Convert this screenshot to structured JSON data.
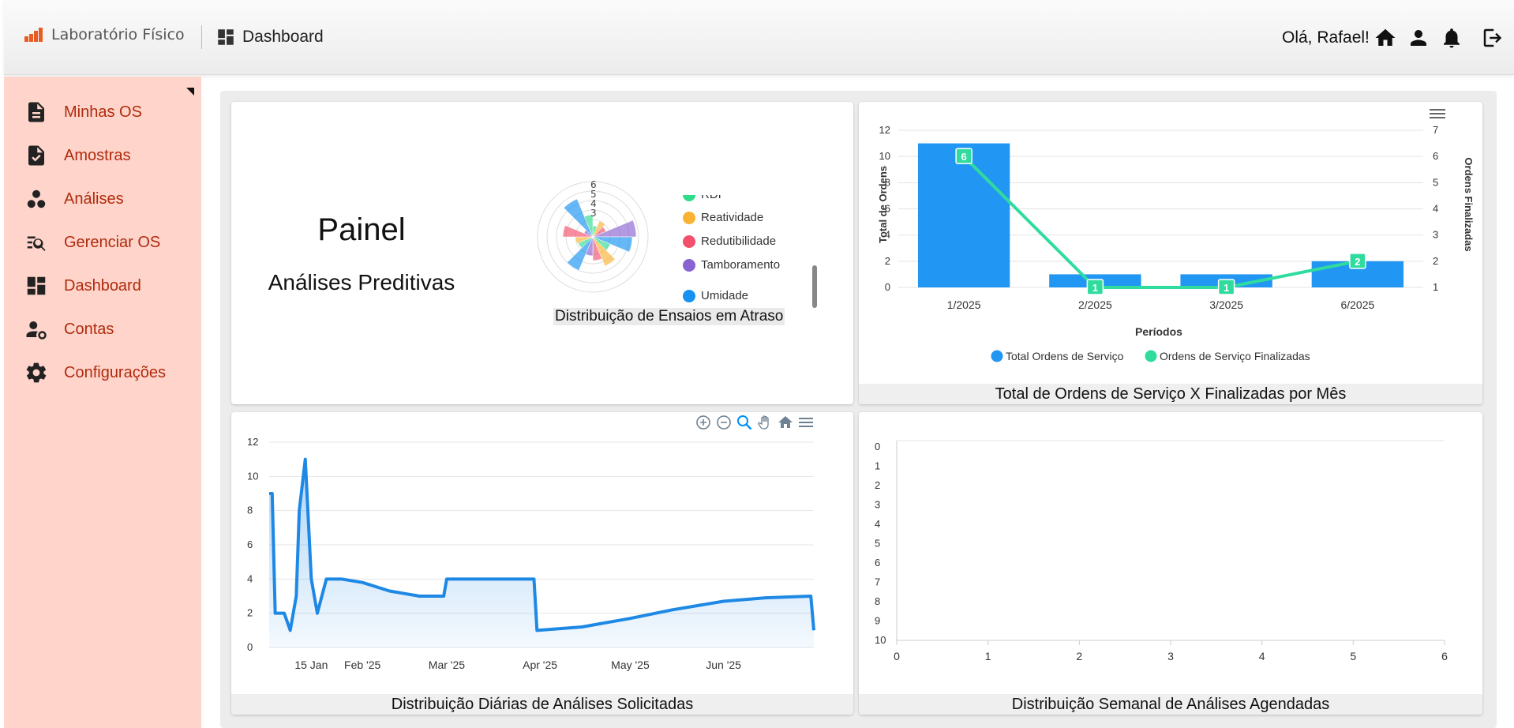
{
  "header": {
    "brand": "Laboratório Físico",
    "page_title": "Dashboard",
    "greeting": "Olá, Rafael!",
    "icons": [
      "home-icon",
      "user-icon",
      "bell-icon",
      "logout-icon"
    ],
    "accent": "#e85d26"
  },
  "sidebar": {
    "background": "#ffd5cb",
    "items": [
      {
        "label": "Minhas OS",
        "icon": "document-icon"
      },
      {
        "label": "Amostras",
        "icon": "checked-document-icon"
      },
      {
        "label": "Análises",
        "icon": "bubbles-icon"
      },
      {
        "label": "Gerenciar OS",
        "icon": "manage-search-icon"
      },
      {
        "label": "Dashboard",
        "icon": "dashboard-icon"
      },
      {
        "label": "Contas",
        "icon": "account-settings-icon"
      },
      {
        "label": "Configurações",
        "icon": "gear-icon"
      }
    ]
  },
  "panel": {
    "title": "Painel",
    "subtitle": "Análises Preditivas"
  },
  "chart_data": [
    {
      "type": "polar-area",
      "caption": "Distribuição de Ensaios em Atraso",
      "radial_ticks": [
        "6",
        "5",
        "4",
        "3"
      ],
      "legend": [
        {
          "label": "RDI",
          "color": "#2fdc8c"
        },
        {
          "label": "Reatividade",
          "color": "#f9b233"
        },
        {
          "label": "Redutibilidade",
          "color": "#f3516b"
        },
        {
          "label": "Tamboramento",
          "color": "#8a63d2"
        },
        {
          "label": "Umidade",
          "color": "#1592f2"
        }
      ]
    },
    {
      "type": "bar",
      "caption": "Total de Ordens de Serviço X Finalizadas por Mês",
      "categories": [
        "1/2025",
        "2/2025",
        "3/2025",
        "6/2025"
      ],
      "xlabel": "Períodos",
      "ylabel": "Total de Ordens",
      "y2label": "Ordens Finalizadas",
      "ylim": [
        0,
        12
      ],
      "y2lim": [
        1,
        7
      ],
      "yticks": [
        "0",
        "2",
        "4",
        "6",
        "8",
        "10",
        "12"
      ],
      "y2ticks": [
        "1",
        "2",
        "3",
        "4",
        "5",
        "6",
        "7"
      ],
      "series": [
        {
          "name": "Total Ordens de Serviço",
          "type": "bar",
          "color": "#2196f3",
          "values": [
            11,
            1,
            1,
            2
          ]
        },
        {
          "name": "Ordens de Serviço Finalizadas",
          "type": "line",
          "axis": "right",
          "color": "#2fdc9e",
          "values": [
            6,
            1,
            1,
            2
          ],
          "labels": [
            "6",
            "1",
            "1",
            "2"
          ]
        }
      ],
      "grid": true,
      "legend": "bottom"
    },
    {
      "type": "area",
      "caption": "Distribuição Diárias de Análises Solicitadas",
      "ylim": [
        0,
        12
      ],
      "yticks": [
        "0",
        "2",
        "4",
        "6",
        "8",
        "10",
        "12"
      ],
      "xticks": [
        "15 Jan",
        "Feb '25",
        "Mar '25",
        "Apr '25",
        "May '25",
        "Jun '25"
      ],
      "x": [
        "2025-01-01",
        "2025-01-02",
        "2025-01-03",
        "2025-01-04",
        "2025-01-05",
        "2025-01-06",
        "2025-01-08",
        "2025-01-10",
        "2025-01-11",
        "2025-01-13",
        "2025-01-15",
        "2025-01-17",
        "2025-01-20",
        "2025-01-25",
        "2025-02-01",
        "2025-02-10",
        "2025-02-20",
        "2025-02-28",
        "2025-03-01",
        "2025-03-15",
        "2025-03-30",
        "2025-03-31",
        "2025-04-15",
        "2025-05-01",
        "2025-05-15",
        "2025-06-01",
        "2025-06-15",
        "2025-06-30",
        "2025-07-01"
      ],
      "values": [
        9,
        9,
        2,
        2,
        2,
        2,
        1,
        3,
        8,
        11,
        4,
        2,
        4,
        4,
        3.8,
        3.3,
        3.0,
        3.0,
        4,
        4,
        4,
        1,
        1.2,
        1.7,
        2.2,
        2.7,
        2.9,
        3,
        1
      ],
      "color": "#1e88e5",
      "toolbar": [
        "zoom-in-icon",
        "zoom-out-icon",
        "magnifier-icon",
        "pan-hand-icon",
        "home-reset-icon",
        "menu-icon"
      ]
    },
    {
      "type": "bar",
      "orientation": "horizontal",
      "caption": "Distribuição Semanal de Análises Agendadas",
      "yticks": [
        "0",
        "1",
        "2",
        "3",
        "4",
        "5",
        "6",
        "7",
        "8",
        "9",
        "10"
      ],
      "xticks": [
        "0",
        "1",
        "2",
        "3",
        "4",
        "5",
        "6"
      ],
      "xlim": [
        0,
        6
      ],
      "values": []
    }
  ]
}
